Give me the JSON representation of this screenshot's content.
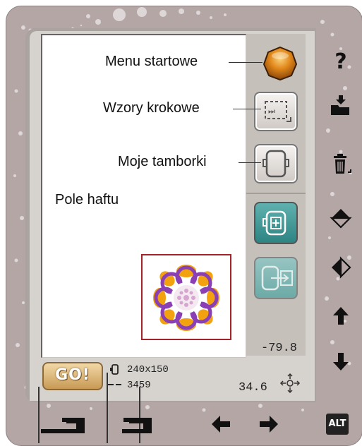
{
  "callouts": {
    "menu_start": "Menu startowe",
    "stitch_patterns": "Wzory krokowe",
    "my_hoops": "Moje tamborki",
    "embroidery_field": "Pole haftu"
  },
  "toolbar_right": {
    "help_glyph": "?",
    "icons": [
      "help-icon",
      "folder-load-icon",
      "trash-icon",
      "vertical-mirror-icon",
      "horizontal-mirror-icon",
      "arrow-up-icon",
      "arrow-down-icon"
    ]
  },
  "status": {
    "hoop_size": "240x150",
    "stitch_count": "3459",
    "coord_y": "-79.8",
    "coord_x": "34.6"
  },
  "go_button": {
    "label": "GO!"
  },
  "alt_button": {
    "label": "ALT"
  },
  "colors": {
    "accent_teal": "#2d8482",
    "orb_orange": "#e1871a",
    "design_purple": "#8a3fb4",
    "design_orange": "#f2a20e",
    "hoop_frame_red": "#a4222a"
  }
}
